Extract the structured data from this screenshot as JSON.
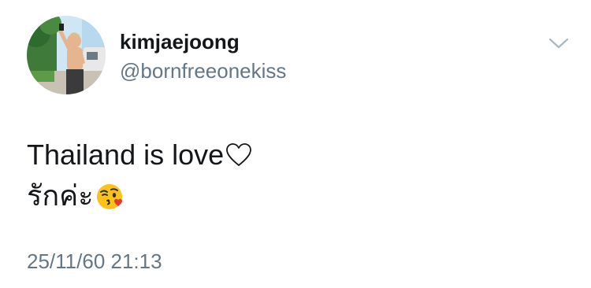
{
  "user": {
    "display_name": "kimjaejoong",
    "handle": "@bornfreeonekiss"
  },
  "tweet": {
    "line1": "Thailand is love",
    "line1_trailing_icon": "heart-outline-icon",
    "line2": "รักค่ะ",
    "line2_trailing_icon": "face-blowing-kiss-emoji",
    "timestamp": "25/11/60 21:13"
  },
  "icons": {
    "menu": "chevron-down-icon"
  },
  "colors": {
    "primary_text": "#14171a",
    "secondary_text": "#657786",
    "background": "#ffffff"
  }
}
